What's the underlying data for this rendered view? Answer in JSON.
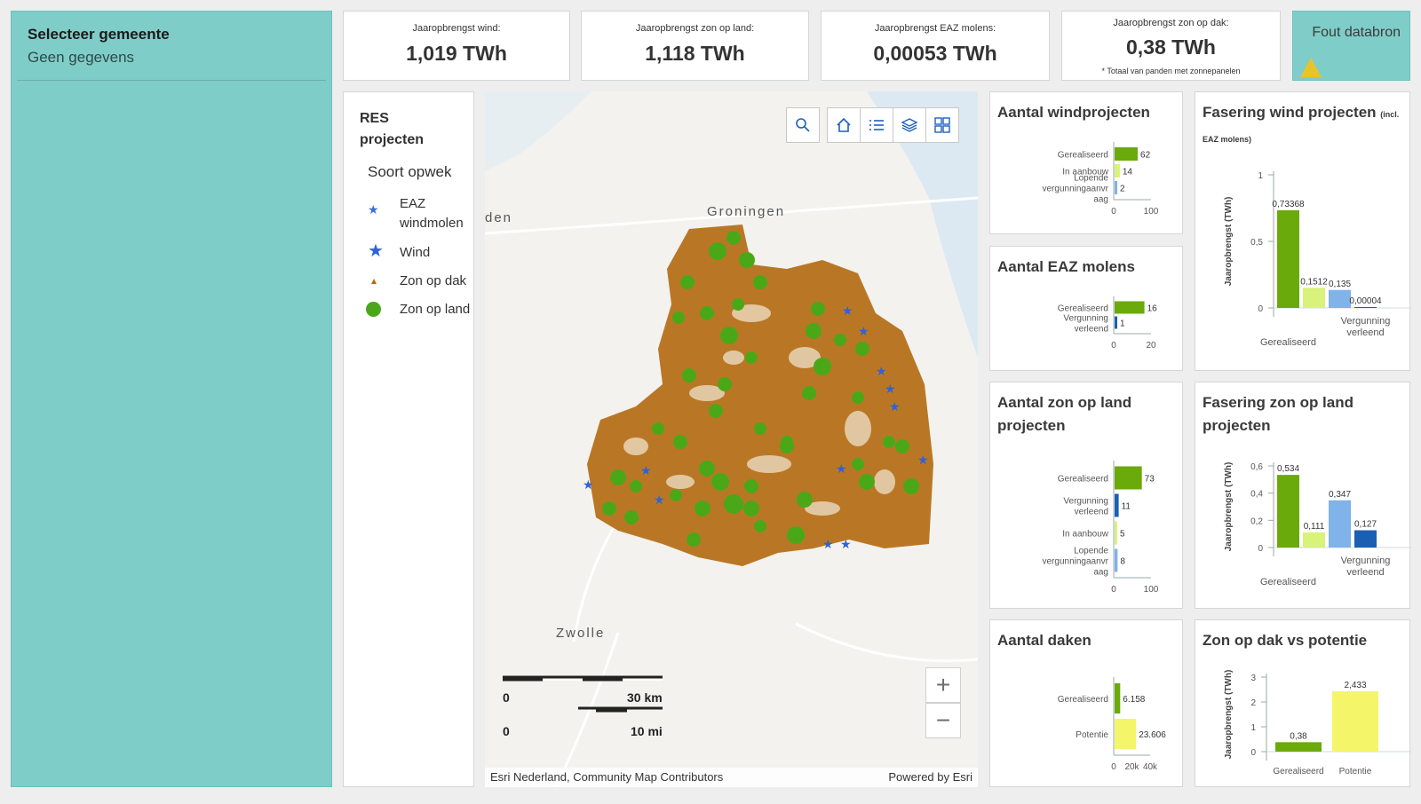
{
  "sidebar": {
    "title": "Selecteer gemeente",
    "subtitle": "Geen gegevens"
  },
  "kpis": [
    {
      "label": "Jaaropbrengst wind:",
      "value": "1,019 TWh",
      "note": ""
    },
    {
      "label": "Jaaropbrengst zon op land:",
      "value": "1,118 TWh",
      "note": ""
    },
    {
      "label": "Jaaropbrengst EAZ molens:",
      "value": "0,00053 TWh",
      "note": ""
    },
    {
      "label": "Jaaropbrengst zon op dak:",
      "value": "0,38 TWh",
      "note": "* Totaal van panden met zonnepanelen"
    }
  ],
  "error_card": {
    "title": "Fout databron",
    "icon": "warning-icon",
    "color": "#e9c32a"
  },
  "legend": {
    "title": "RES projecten",
    "subtitle": "Soort opwek",
    "items": [
      {
        "label": "EAZ windmolen",
        "icon": "small-star-icon",
        "color": "#3a6fd8"
      },
      {
        "label": "Wind",
        "icon": "star-icon",
        "color": "#2e62d6"
      },
      {
        "label": "Zon op dak",
        "icon": "small-triangle-icon",
        "color": "#b86a10"
      },
      {
        "label": "Zon op land",
        "icon": "circle-icon",
        "color": "#4aa818"
      }
    ]
  },
  "map": {
    "city_labels": [
      "Groningen",
      "Zwolle",
      "den"
    ],
    "scale_km": "30 km",
    "scale_mi": "10 mi",
    "scale_zero_1": "0",
    "scale_zero_2": "0",
    "attribution": "Esri Nederland, Community Map Contributors",
    "powered": "Powered by Esri",
    "tools": [
      "search-icon",
      "home-icon",
      "list-icon",
      "layers-icon",
      "qr-icon"
    ],
    "zoom_in": "+",
    "zoom_out": "−",
    "colors": {
      "zon_op_dak": "#b86a10",
      "zon_op_land": "#4aa818",
      "wind": "#2e62d6"
    }
  },
  "charts": {
    "windprojecten": {
      "title": "Aantal windprojecten",
      "categories": [
        "Gerealiseerd",
        "In aanbouw",
        "Lopende vergunningaanvraag"
      ],
      "category_lines": [
        [
          "Gerealiseerd"
        ],
        [
          "In aanbouw"
        ],
        [
          "Lopende",
          "vergunningaanvr",
          "aag"
        ]
      ],
      "values": [
        62,
        14,
        2
      ],
      "value_labels": [
        "62",
        "14",
        "2"
      ],
      "colors": [
        "#6aaa0a",
        "#d8f27a",
        "#7fb3ea"
      ],
      "ticks": [
        "0",
        "100"
      ]
    },
    "eaz": {
      "title": "Aantal EAZ molens",
      "categories": [
        "Gerealiseerd",
        "Vergunning verleend"
      ],
      "category_lines": [
        [
          "Gerealiseerd"
        ],
        [
          "Vergunning",
          "verleend"
        ]
      ],
      "values": [
        16,
        1
      ],
      "value_labels": [
        "16",
        "1"
      ],
      "colors": [
        "#6aaa0a",
        "#1a5fb4"
      ],
      "ticks": [
        "0",
        "20"
      ]
    },
    "zonland": {
      "title": "Aantal zon op land projecten",
      "categories": [
        "Gerealiseerd",
        "Vergunning verleend",
        "In aanbouw",
        "Lopende vergunningaanvraag"
      ],
      "category_lines": [
        [
          "Gerealiseerd"
        ],
        [
          "Vergunning",
          "verleend"
        ],
        [
          "In aanbouw"
        ],
        [
          "Lopende",
          "vergunningaanvr",
          "aag"
        ]
      ],
      "values": [
        73,
        11,
        5,
        8
      ],
      "value_labels": [
        "73",
        "11",
        "5",
        "8"
      ],
      "colors": [
        "#6aaa0a",
        "#1a5fb4",
        "#d8f27a",
        "#7fb3ea"
      ],
      "ticks": [
        "0",
        "100"
      ]
    },
    "daken": {
      "title": "Aantal daken",
      "categories": [
        "Gerealiseerd",
        "Potentie"
      ],
      "category_lines": [
        [
          "Gerealiseerd"
        ],
        [
          "Potentie"
        ]
      ],
      "values": [
        6158,
        23606
      ],
      "value_labels": [
        "6.158",
        "23.606"
      ],
      "colors": [
        "#6aaa0a",
        "#f5f56a"
      ],
      "ticks": [
        "0",
        "20k",
        "40k"
      ]
    },
    "fasering_wind": {
      "title": "Fasering wind projecten",
      "title_small": "(incl. EAZ molens)",
      "ylabel": "Jaaropbrengst (TWh)",
      "y_ticks": [
        "1",
        "0,5",
        "0"
      ],
      "values": [
        0.73368,
        0.1512,
        0.135,
        4e-05
      ],
      "value_labels": [
        "0,73368",
        "0,1512",
        "0,135",
        "0,00004"
      ],
      "colors": [
        "#6aaa0a",
        "#d8f27a",
        "#7fb3ea",
        "#1a5fb4"
      ],
      "x_labels": [
        "Gerealiseerd",
        "Vergunning verleend"
      ]
    },
    "fasering_zon": {
      "title": "Fasering zon op land projecten",
      "ylabel": "Jaaropbrengst (TWh)",
      "y_ticks": [
        "0,6",
        "0,4",
        "0,2",
        "0"
      ],
      "values": [
        0.534,
        0.111,
        0.347,
        0.127
      ],
      "value_labels": [
        "0,534",
        "0,111",
        "0,347",
        "0,127"
      ],
      "colors": [
        "#6aaa0a",
        "#d8f27a",
        "#7fb3ea",
        "#1a5fb4"
      ],
      "x_labels": [
        "Gerealiseerd",
        "Vergunning verleend"
      ]
    },
    "zon_dak_potentie": {
      "title": "Zon op dak vs potentie",
      "ylabel": "Jaaropbrengst (TWh)",
      "y_ticks": [
        "3",
        "2",
        "1",
        "0"
      ],
      "values": [
        0.38,
        2.433
      ],
      "value_labels": [
        "0,38",
        "2,433"
      ],
      "colors": [
        "#6aaa0a",
        "#f5f56a"
      ],
      "x_labels": [
        "Gerealiseerd",
        "Potentie"
      ]
    }
  },
  "chart_data": [
    {
      "type": "bar",
      "title": "Aantal windprojecten",
      "categories": [
        "Gerealiseerd",
        "In aanbouw",
        "Lopende vergunningaanvraag"
      ],
      "values": [
        62,
        14,
        2
      ],
      "xlim": [
        0,
        100
      ]
    },
    {
      "type": "bar",
      "title": "Aantal EAZ molens",
      "categories": [
        "Gerealiseerd",
        "Vergunning verleend"
      ],
      "values": [
        16,
        1
      ],
      "xlim": [
        0,
        20
      ]
    },
    {
      "type": "bar",
      "title": "Aantal zon op land projecten",
      "categories": [
        "Gerealiseerd",
        "Vergunning verleend",
        "In aanbouw",
        "Lopende vergunningaanvraag"
      ],
      "values": [
        73,
        11,
        5,
        8
      ],
      "xlim": [
        0,
        100
      ]
    },
    {
      "type": "bar",
      "title": "Aantal daken",
      "categories": [
        "Gerealiseerd",
        "Potentie"
      ],
      "values": [
        6158,
        23606
      ],
      "xlim": [
        0,
        40000
      ]
    },
    {
      "type": "bar",
      "title": "Fasering wind projecten (incl. EAZ molens)",
      "ylabel": "Jaaropbrengst (TWh)",
      "values": [
        0.73368,
        0.1512,
        0.135,
        4e-05
      ],
      "ylim": [
        0,
        1
      ]
    },
    {
      "type": "bar",
      "title": "Fasering zon op land projecten",
      "ylabel": "Jaaropbrengst (TWh)",
      "values": [
        0.534,
        0.111,
        0.347,
        0.127
      ],
      "ylim": [
        0,
        0.6
      ]
    },
    {
      "type": "bar",
      "title": "Zon op dak vs potentie",
      "ylabel": "Jaaropbrengst (TWh)",
      "categories": [
        "Gerealiseerd",
        "Potentie"
      ],
      "values": [
        0.38,
        2.433
      ],
      "ylim": [
        0,
        3
      ]
    }
  ]
}
